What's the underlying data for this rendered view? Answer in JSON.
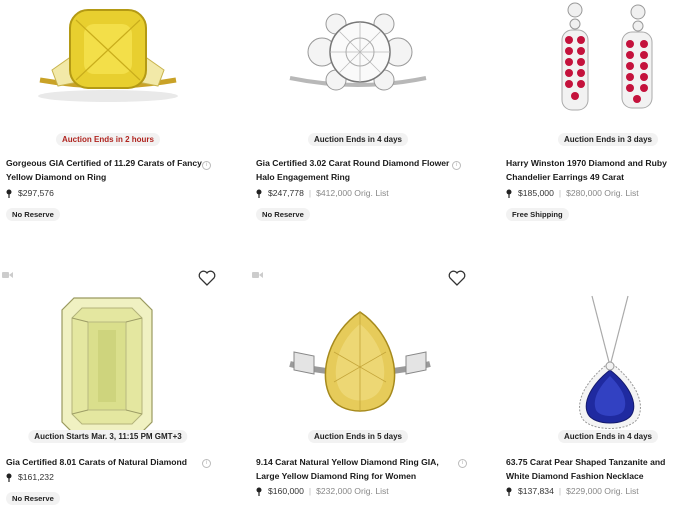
{
  "listings": [
    {
      "badge": "Auction Ends in 2 hours",
      "title": "Gorgeous GIA Certified of 11.29 Carats of Fancy Yellow Diamond on Ring",
      "price": "$297,576",
      "orig_price": "",
      "tag": "No Reserve",
      "image": "yellow-cushion-diamond-ring"
    },
    {
      "badge": "Auction Ends in 4 days",
      "title": "Gia Certified 3.02 Carat Round Diamond Flower Halo Engagement Ring",
      "price": "$247,778",
      "orig_price": "$412,000 Orig. List",
      "tag": "No Reserve",
      "image": "round-diamond-halo-ring"
    },
    {
      "badge": "Auction Ends in 3 days",
      "title": "Harry Winston 1970 Diamond and Ruby Chandelier Earrings 49 Carat",
      "price": "$185,000",
      "orig_price": "$280,000 Orig. List",
      "tag": "Free Shipping",
      "image": "ruby-diamond-chandelier-earrings"
    },
    {
      "badge": "Auction Starts Mar. 3, 11:15 PM GMT+3",
      "title": "Gia Certified 8.01 Carats of Natural Diamond",
      "price": "$161,232",
      "orig_price": "",
      "tag": "No Reserve",
      "image": "emerald-cut-diamond"
    },
    {
      "badge": "Auction Ends in 5 days",
      "title": "9.14 Carat Natural Yellow Diamond Ring GIA, Large Yellow Diamond Ring for Women",
      "price": "$160,000",
      "orig_price": "$232,000 Orig. List",
      "tag": "",
      "image": "yellow-pear-diamond-ring"
    },
    {
      "badge": "Auction Ends in 4 days",
      "title": "63.75 Carat Pear Shaped Tanzanite and White Diamond Fashion Necklace",
      "price": "$137,834",
      "orig_price": "$229,000 Orig. List",
      "tag": "",
      "image": "tanzanite-pear-necklace"
    }
  ],
  "colors": {
    "urgent": "#b0241f",
    "badge_bg": "#f2f2f2"
  }
}
